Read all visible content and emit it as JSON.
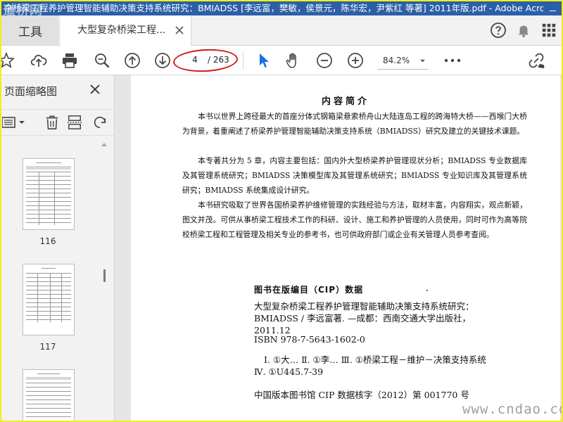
{
  "window": {
    "title": "杂桥梁工程养护管理智能辅助决策支持系统研究：BMIADSS [李远富，樊敏，侯景元，陈华宏，尹紫红 等著] 2011年版.pdf - Adobe Acrob...",
    "watermark_top": "道桥网"
  },
  "tabs": {
    "tools_label": "工具",
    "doc_tab_label": "大型复杂桥梁工程..."
  },
  "toolbar": {
    "current_page": "4",
    "total_pages": "/ 263",
    "zoom": "84.2%"
  },
  "sidebar": {
    "title": "页面缩略图",
    "thumbnails": [
      {
        "label": "116"
      },
      {
        "label": "117"
      }
    ]
  },
  "document": {
    "heading": "内容简介",
    "paragraphs": [
      "本书以世界上跨径最大的首座分体式钢箱梁悬索桥舟山大陆连岛工程的跨海特大桥——西堠门大桥为背景，着重阐述了桥梁养护管理智能辅助决策支持系统（BMIADSS）研究及建立的关键技术课题。",
      "本专著共分为 5 章，内容主要包括：国内外大型桥梁养护管理现状分析；BMIADSS 专业数据库及其管理系统研究；BMIADSS 决策模型库及其管理系统研究；BMIADSS 专业知识库及其管理系统研究；BMIADSS 系统集成设计研究。",
      "本书研究吸取了世界各国桥梁养护维修管理的实践经验与方法，取材丰富，内容翔实，观点新颖，图文并茂。可供从事桥梁工程技术工作的科研、设计、施工和养护管理的人员使用，同时可作为高等院校桥梁工程和工程管理及相关专业的参考书，也可供政府部门或企业有关管理人员参考查阅。"
    ],
    "cip_heading": "图书在版编目（CIP）数据",
    "cip_lines": [
      "大型复杂桥梁工程养护管理智能辅助决策支持系统研究：BMIADSS / 李远富著. —成都：西南交通大学出版社，2011.12",
      "ISBN 978-7-5643-1602-0",
      "Ⅰ. ①大… Ⅱ. ①李… Ⅲ. ①桥梁工程－维护－决策支持系统 Ⅳ. ①U445.7-39",
      "中国版本图书馆 CIP 数据核字（2012）第 001770 号"
    ],
    "watermark_bottom": "www.cndao.com"
  },
  "colors": {
    "title_bar": "#2b5fa8",
    "frame": "#f2ee1a",
    "highlight_ellipse": "#d21d1d",
    "cursor_blue": "#1473e6"
  }
}
